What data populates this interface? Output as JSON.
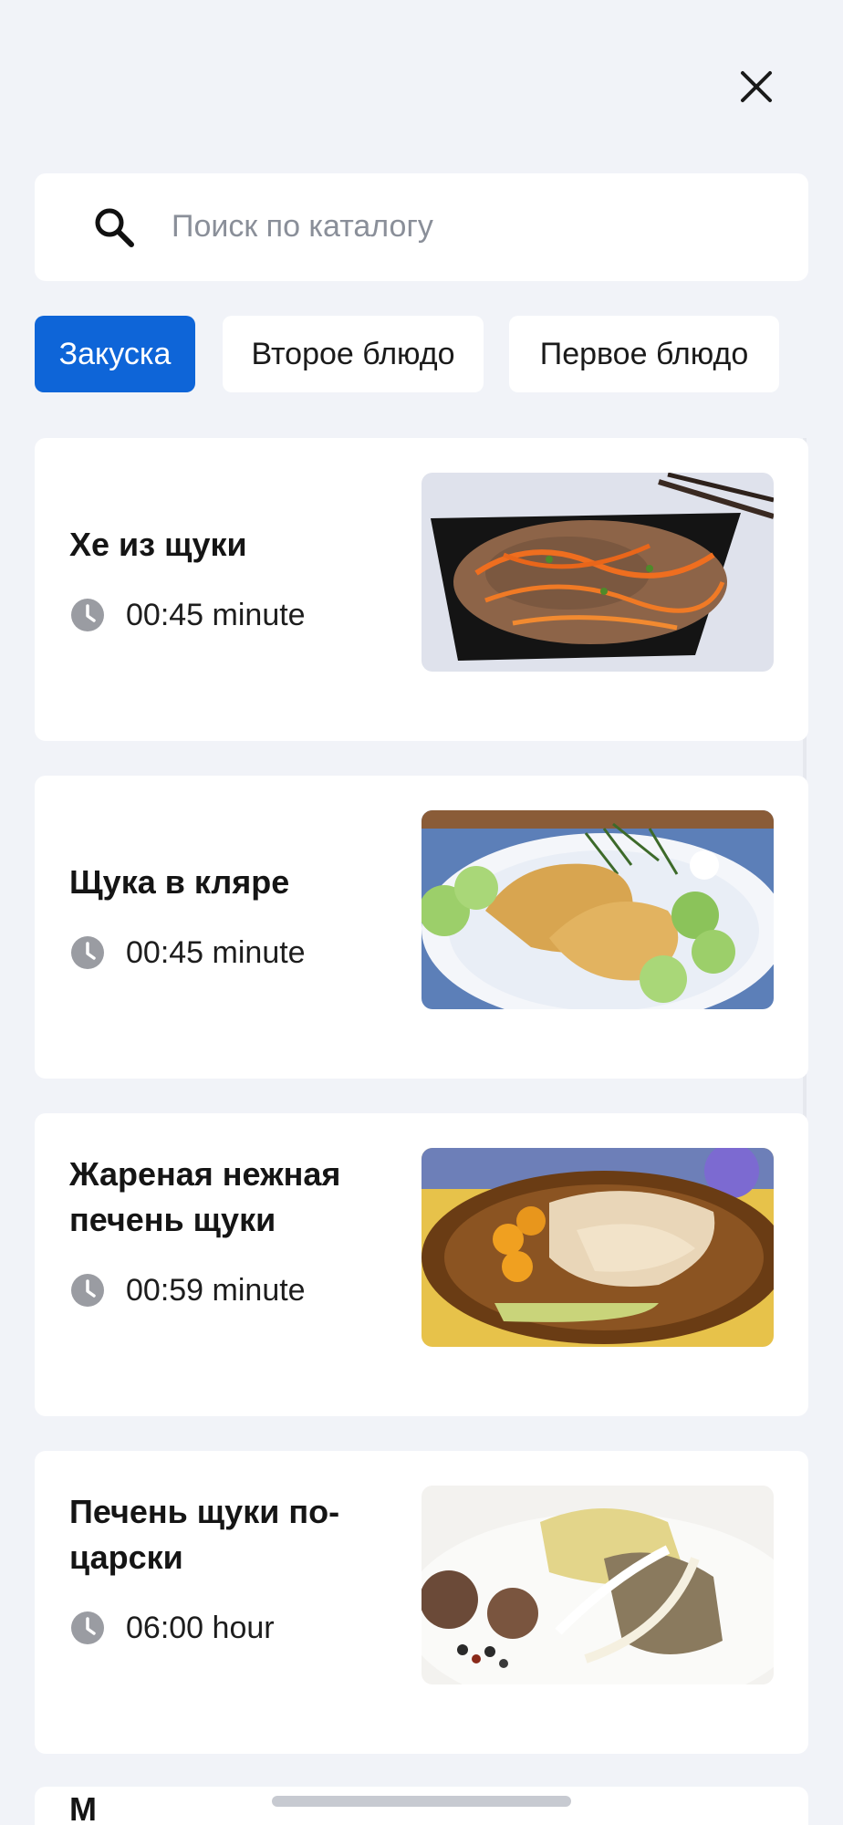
{
  "close_icon": "close-icon",
  "search": {
    "placeholder": "Поиск по каталогу",
    "icon": "search-icon"
  },
  "categories": [
    {
      "label": "Закуска",
      "active": true
    },
    {
      "label": "Второе блюдо",
      "active": false
    },
    {
      "label": "Первое блюдо",
      "active": false
    }
  ],
  "recipes": [
    {
      "title": "Хе из щуки",
      "time": "00:45 minute",
      "image": "spicy pike salad with carrots"
    },
    {
      "title": "Щука в кляре",
      "time": "00:45 minute",
      "image": "battered pike with cucumbers and dill"
    },
    {
      "title": "Жареная нежная печень щуки",
      "time": "00:59 minute",
      "image": "fried pike liver with tomatoes"
    },
    {
      "title": "Печень щуки по-царски",
      "time": "06:00 hour",
      "image": "pike liver with onion and spices"
    }
  ],
  "next_card_peek": "М",
  "colors": {
    "accent": "#0e65d8",
    "background": "#f1f3f8",
    "card": "#ffffff"
  }
}
